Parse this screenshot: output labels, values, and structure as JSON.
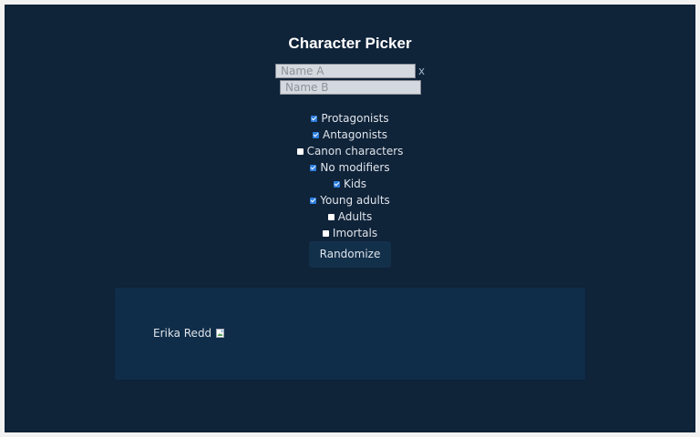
{
  "header": {
    "title": "Character Picker"
  },
  "inputs": {
    "name_a_placeholder": "Name A",
    "name_b_placeholder": "Name B",
    "clear_label": "x"
  },
  "options": [
    {
      "label": "Protagonists",
      "checked": true
    },
    {
      "label": "Antagonists",
      "checked": true
    },
    {
      "label": "Canon characters",
      "checked": false
    },
    {
      "label": "No modifiers",
      "checked": true
    },
    {
      "label": "Kids",
      "checked": true
    },
    {
      "label": "Young adults",
      "checked": true
    },
    {
      "label": "Adults",
      "checked": false
    },
    {
      "label": "Imortals",
      "checked": false
    }
  ],
  "actions": {
    "randomize_label": "Randomize"
  },
  "result": {
    "name": "Erika Redd",
    "image_icon": "broken-image-icon"
  },
  "colors": {
    "background": "#0f2339",
    "panel": "#0f2d49",
    "button": "#13304b",
    "checkbox_checked": "#2f7fe0"
  }
}
